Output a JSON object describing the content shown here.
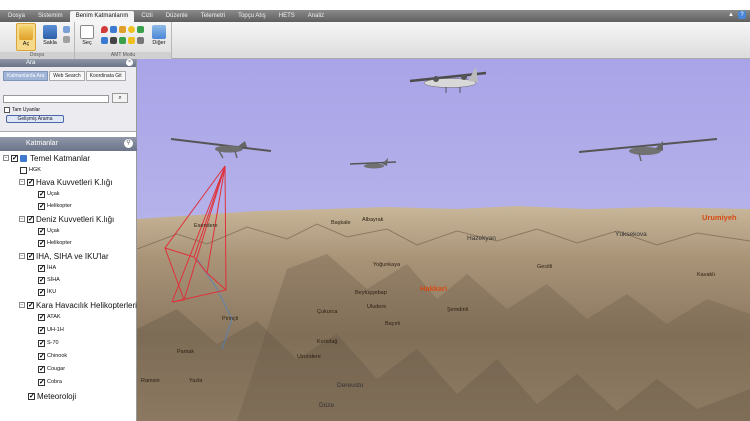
{
  "menubar": {
    "tabs": [
      "Dosya",
      "Sistemim",
      "Benim Katmanlarım",
      "Cizli",
      "Düzenle",
      "Telemetri",
      "Topçu Atış",
      "HETS",
      "Analiz"
    ],
    "active_index": 2
  },
  "ribbon": {
    "groups": [
      {
        "label": "Dosya",
        "buttons": [
          "Aç",
          "Sakla"
        ]
      },
      {
        "label": "AMT Modu",
        "buttons": [
          "Seç",
          "Diğer"
        ]
      }
    ]
  },
  "search": {
    "title": "Ara",
    "tabs": [
      "Katmanlarda Ara",
      "Web Search",
      "Koordinata Git"
    ],
    "active_tab": 0,
    "input_value": "",
    "search_icon": "search-icon",
    "exact_label": "Tam Uyanlar",
    "advanced_label": "Gelişmiş Arama"
  },
  "layers": {
    "title": "Katmanlar",
    "root": "Temel Katmanlar",
    "items": [
      {
        "label": "HGK",
        "level": 1,
        "checked": false
      },
      {
        "label": "Hava Kuvvetleri K.lığı",
        "level": 1,
        "checked": true,
        "group": true
      },
      {
        "label": "Uçak",
        "level": 2,
        "checked": true
      },
      {
        "label": "Helikopter",
        "level": 2,
        "checked": true
      },
      {
        "label": "Deniz Kuvvetleri K.lığı",
        "level": 1,
        "checked": true,
        "group": true
      },
      {
        "label": "Uçak",
        "level": 2,
        "checked": true
      },
      {
        "label": "Helikopter",
        "level": 2,
        "checked": true
      },
      {
        "label": "IHA, SIHA ve IKU'lar",
        "level": 1,
        "checked": true,
        "group": true
      },
      {
        "label": "İHA",
        "level": 2,
        "checked": true
      },
      {
        "label": "SİHA",
        "level": 2,
        "checked": true
      },
      {
        "label": "İKU",
        "level": 2,
        "checked": true
      },
      {
        "label": "Kara Havacılık Helikopterleri",
        "level": 1,
        "checked": true,
        "group": true
      },
      {
        "label": "ATAK",
        "level": 2,
        "checked": true
      },
      {
        "label": "UH-1H",
        "level": 2,
        "checked": true
      },
      {
        "label": "S-70",
        "level": 2,
        "checked": true
      },
      {
        "label": "Chinook",
        "level": 2,
        "checked": true
      },
      {
        "label": "Cougar",
        "level": 2,
        "checked": true
      },
      {
        "label": "Cobra",
        "level": 2,
        "checked": true
      },
      {
        "label": "Meteoroloji",
        "level": 1,
        "checked": true
      }
    ]
  },
  "map": {
    "places": [
      {
        "name": "Hakkari",
        "kind": "major"
      },
      {
        "name": "Urumiyeh",
        "kind": "major"
      },
      {
        "name": "Hazekyan",
        "kind": "mid"
      },
      {
        "name": "Yüksekova",
        "kind": "mid"
      },
      {
        "name": "Dereustu",
        "kind": "mid"
      },
      {
        "name": "Düze",
        "kind": "mid"
      },
      {
        "name": "Beytüşşebap",
        "kind": "minor"
      },
      {
        "name": "Uludere",
        "kind": "minor"
      },
      {
        "name": "Şemdinli",
        "kind": "minor"
      },
      {
        "name": "Çukurca",
        "kind": "minor"
      },
      {
        "name": "Başkale",
        "kind": "minor"
      },
      {
        "name": "Albayrak",
        "kind": "minor"
      },
      {
        "name": "Esendere",
        "kind": "minor"
      },
      {
        "name": "Pirinçli",
        "kind": "minor"
      },
      {
        "name": "Kırıkdağ",
        "kind": "minor"
      },
      {
        "name": "Uzundere",
        "kind": "minor"
      },
      {
        "name": "Yoğunkaya",
        "kind": "minor"
      },
      {
        "name": "Pamak",
        "kind": "minor"
      },
      {
        "name": "Bayırlı",
        "kind": "minor"
      },
      {
        "name": "Ramsin",
        "kind": "minor"
      },
      {
        "name": "Yazla",
        "kind": "minor"
      },
      {
        "name": "Gecitli",
        "kind": "minor"
      },
      {
        "name": "Kavaklı",
        "kind": "minor"
      }
    ],
    "aircraft": [
      "drone-1",
      "plane",
      "drone-2",
      "drone-3"
    ]
  }
}
